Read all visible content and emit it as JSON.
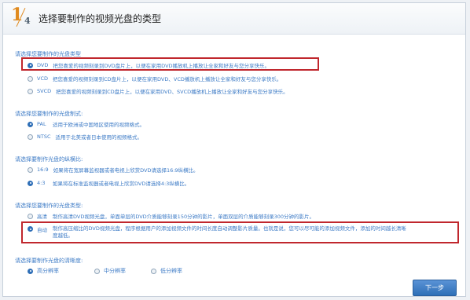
{
  "header": {
    "step_current": "1",
    "step_total": "4",
    "title": "选择要制作的视频光盘的类型"
  },
  "disc_type": {
    "title": "请选择您要制作的光盘类型",
    "options": [
      {
        "label": "DVD",
        "desc": "把您喜爱的视频刻录到DVD盘片上，以便在家用DVD播放机上播放让全家和好友与您分享快乐。",
        "checked": true
      },
      {
        "label": "VCD",
        "desc": "把您喜爱的视频刻录到CD盘片上，以便在家用DVD、VCD播放机上播放让全家和好友与您分享快乐。",
        "checked": false
      },
      {
        "label": "SVCD",
        "desc": "把您喜爱的视频刻录到CD盘片上，以便在家用DVD、SVCD播放机上播放让全家和好友与您分享快乐。",
        "checked": false
      }
    ]
  },
  "format": {
    "title": "请选择您要制作的光盘制式:",
    "options": [
      {
        "label": "PAL",
        "desc": "适用于欧洲或中国地区使用的视频格式。",
        "checked": true
      },
      {
        "label": "NTSC",
        "desc": "适用于北美或者日本使用的视频格式。",
        "checked": false
      }
    ]
  },
  "aspect": {
    "title": "请选择要制作光盘的纵横比:",
    "options": [
      {
        "label": "16:9",
        "desc": "如果将在宽屏幕监视器或者电视上欣赏DVD请选择16:9纵横比。",
        "checked": false
      },
      {
        "label": "4:3",
        "desc": "如果将在标准监视器或者电视上欣赏DVD请选择4:3纵横比。",
        "checked": true
      }
    ]
  },
  "quality_type": {
    "title": "请选择您要制作的光盘类型:",
    "options": [
      {
        "label": "高清",
        "desc": "制作高清DVD视频光盘，单面单层的DVD介质能够刻录150分钟的影片，单面双层的介质能够刻录300分钟的影片。",
        "checked": false
      },
      {
        "label": "自动",
        "desc": "制作高压缩比的DVD视频光盘，程序根据用户的添加视频文件的时间长度自动调整影片质量。也就是说，您可以尽可能的添加视频文件，添加的时间越长清晰度越低。",
        "checked": true
      }
    ]
  },
  "clarity": {
    "title": "请选择要制作光盘的清晰度:",
    "options": [
      {
        "label": "高分辨率",
        "checked": true
      },
      {
        "label": "中分辨率",
        "checked": false
      },
      {
        "label": "低分辨率",
        "checked": false
      }
    ]
  },
  "footer": {
    "next_label": "下一步"
  },
  "colors": {
    "accent": "#3d7bc6",
    "highlight": "#c0272d",
    "step": "#e08a1e"
  }
}
